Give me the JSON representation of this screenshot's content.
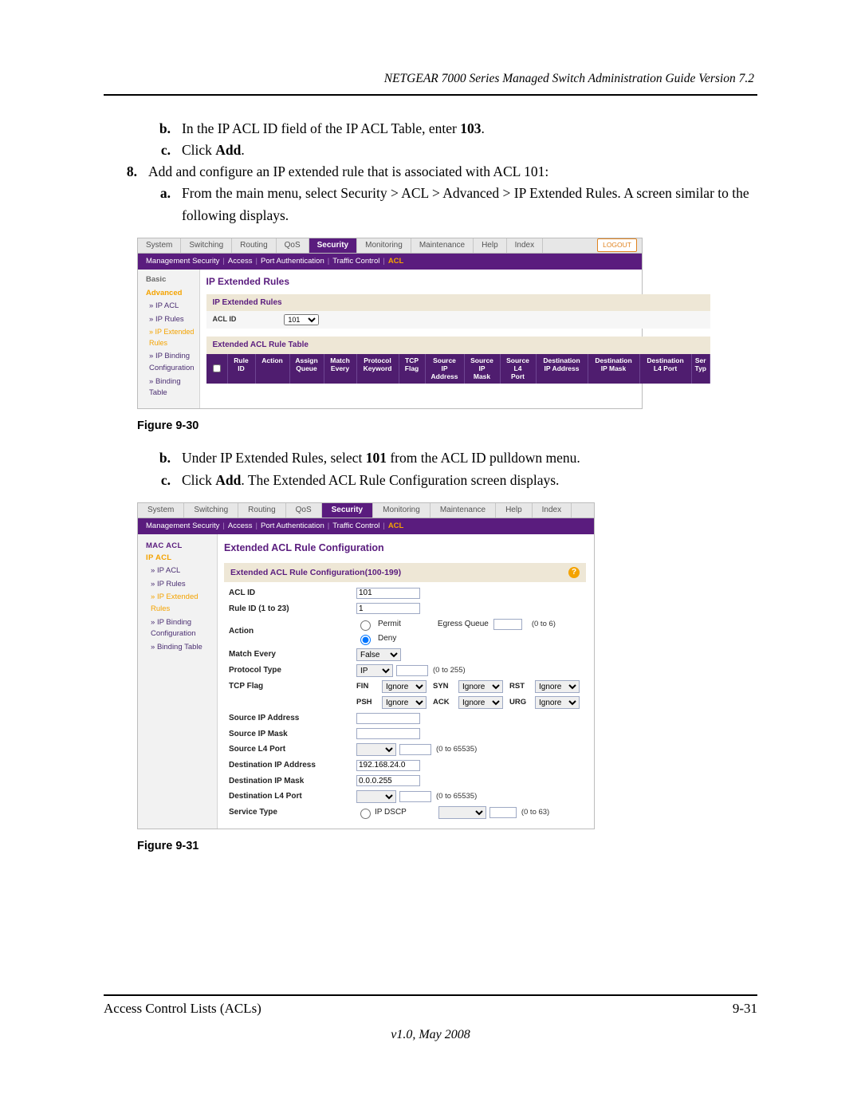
{
  "header_title": "NETGEAR 7000 Series Managed Switch Administration Guide Version 7.2",
  "steps": {
    "s7b_prefix": "b.",
    "s7b": "In the IP ACL ID field of the IP ACL Table, enter ",
    "s7b_bold": "103",
    "s7b_suffix": ".",
    "s7c_prefix": "c.",
    "s7c": "Click ",
    "s7c_bold": "Add",
    "s7c_suffix": ".",
    "s8_prefix": "8.",
    "s8": "Add and configure an IP extended rule that is associated with ACL 101:",
    "s8a_prefix": "a.",
    "s8a": "From the main menu, select Security > ACL > Advanced > IP Extended Rules. A screen similar to the following displays.",
    "s8b_prefix": "b.",
    "s8b_a": "Under IP Extended Rules, select ",
    "s8b_bold": "101",
    "s8b_b": " from the ACL ID pulldown menu.",
    "s8c_prefix": "c.",
    "s8c_a": "Click ",
    "s8c_bold": "Add",
    "s8c_b": ". The Extended ACL Rule Configuration screen displays."
  },
  "fig30_caption": "Figure 9-30",
  "fig31_caption": "Figure 9-31",
  "fig30": {
    "tabs": [
      "System",
      "Switching",
      "Routing",
      "QoS",
      "Security",
      "Monitoring",
      "Maintenance",
      "Help",
      "Index"
    ],
    "active_tab": "Security",
    "logout": "LOGOUT",
    "subtabs": [
      "Management Security",
      "Access",
      "Port Authentication",
      "Traffic Control",
      "ACL"
    ],
    "active_subtab": "ACL",
    "side": {
      "basic": "Basic",
      "advanced": "Advanced",
      "items": [
        "IP ACL",
        "IP Rules",
        "IP Extended Rules",
        "IP Binding Configuration",
        "Binding Table"
      ],
      "active_item": "IP Extended Rules"
    },
    "main_heading": "IP Extended Rules",
    "panel1_title": "IP Extended Rules",
    "aclid_label": "ACL ID",
    "aclid_value": "101",
    "panel2_title": "Extended ACL Rule Table",
    "columns": [
      "",
      "Rule\nID",
      "Action",
      "Assign\nQueue",
      "Match\nEvery",
      "Protocol\nKeyword",
      "TCP\nFlag",
      "Source\nIP\nAddress",
      "Source\nIP\nMask",
      "Source\nL4\nPort",
      "Destination\nIP Address",
      "Destination\nIP Mask",
      "Destination\nL4 Port",
      "Ser\nTyp"
    ]
  },
  "fig31": {
    "tabs": [
      "System",
      "Switching",
      "Routing",
      "QoS",
      "Security",
      "Monitoring",
      "Maintenance",
      "Help",
      "Index"
    ],
    "active_tab": "Security",
    "subtabs": [
      "Management Security",
      "Access",
      "Port Authentication",
      "Traffic Control",
      "ACL"
    ],
    "active_subtab": "ACL",
    "side": {
      "heading1": "MAC ACL",
      "heading2": "IP ACL",
      "items": [
        "IP ACL",
        "IP Rules",
        "IP Extended Rules",
        "IP Binding Configuration",
        "Binding Table"
      ],
      "active_item": "IP Extended Rules"
    },
    "main_heading": "Extended ACL Rule Configuration",
    "panel_title": "Extended ACL Rule Configuration(100-199)",
    "fields": {
      "aclid_label": "ACL ID",
      "aclid_value": "101",
      "ruleid_label": "Rule ID (1 to 23)",
      "ruleid_value": "1",
      "action_label": "Action",
      "action_permit": "Permit",
      "action_deny": "Deny",
      "egress_label": "Egress Queue",
      "egress_hint": "(0 to 6)",
      "matchevery_label": "Match Every",
      "matchevery_value": "False",
      "protocol_label": "Protocol Type",
      "protocol_value": "IP",
      "protocol_hint": "(0 to 255)",
      "tcpflag_label": "TCP Flag",
      "flags": [
        "FIN",
        "SYN",
        "RST",
        "PSH",
        "ACK",
        "URG"
      ],
      "flag_value": "Ignore",
      "srcip_label": "Source IP Address",
      "srcmask_label": "Source IP Mask",
      "srcl4_label": "Source L4 Port",
      "srcl4_hint": "(0 to 65535)",
      "dstip_label": "Destination IP Address",
      "dstip_value": "192.168.24.0",
      "dstmask_label": "Destination IP Mask",
      "dstmask_value": "0.0.0.255",
      "dstl4_label": "Destination L4 Port",
      "dstl4_hint": "(0 to 65535)",
      "service_label": "Service Type",
      "service_radio": "IP DSCP",
      "service_hint": "(0 to 63)"
    }
  },
  "footer_left": "Access Control Lists (ACLs)",
  "footer_right": "9-31",
  "footer_version": "v1.0, May 2008"
}
